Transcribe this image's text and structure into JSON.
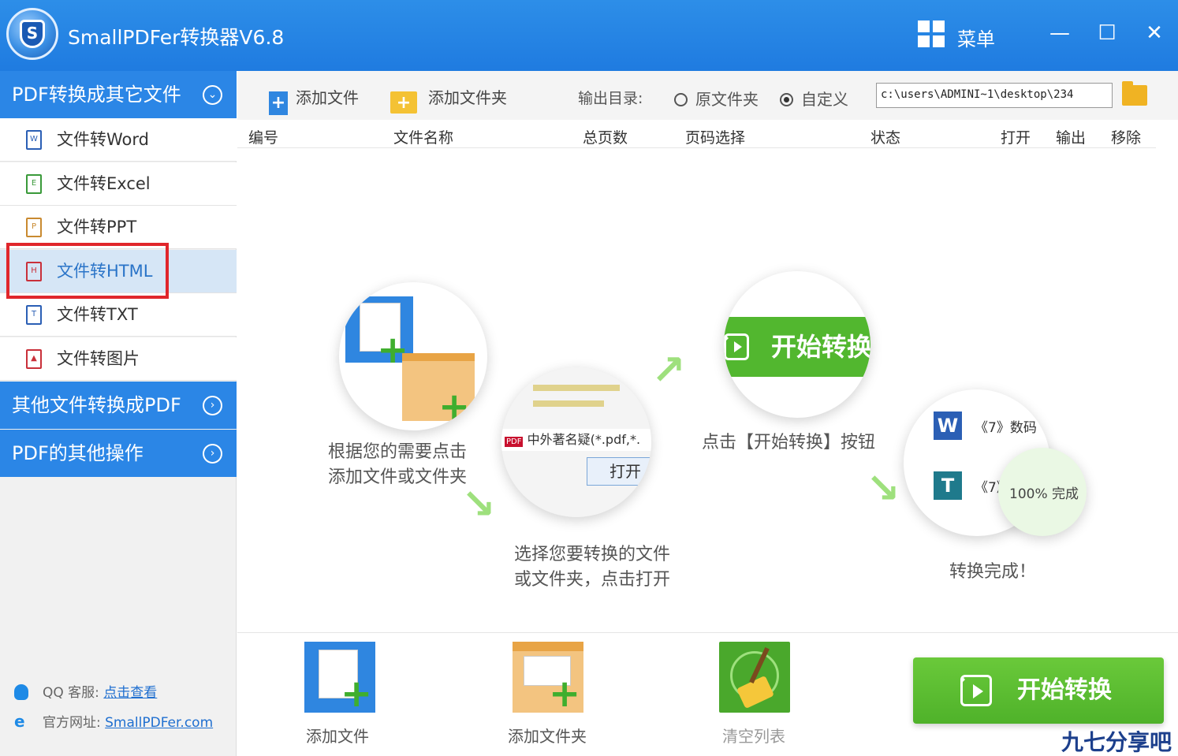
{
  "app": {
    "title": "SmallPDFer转换器V6.8",
    "menu_label": "菜单",
    "minimize": "—",
    "maximize": "☐",
    "close": "✕"
  },
  "sidebar": {
    "section1": "PDF转换成其它文件",
    "items": [
      {
        "label": "文件转Word",
        "icon": "W",
        "color": "#2b5fb5"
      },
      {
        "label": "文件转Excel",
        "icon": "E",
        "color": "#3a9a3a"
      },
      {
        "label": "文件转PPT",
        "icon": "P",
        "color": "#c98a30"
      },
      {
        "label": "文件转HTML",
        "icon": "H",
        "color": "#c9303a"
      },
      {
        "label": "文件转TXT",
        "icon": "T",
        "color": "#2b5fb5"
      },
      {
        "label": "文件转图片",
        "icon": "▲",
        "color": "#c9303a"
      }
    ],
    "section2": "其他文件转换成PDF",
    "section3": "PDF的其他操作",
    "qq_label": "QQ 客服:",
    "qq_link": "点击查看",
    "site_label": "官方网址:",
    "site_link": "SmallPDFer.com"
  },
  "toolbar": {
    "add_file": "添加文件",
    "add_folder": "添加文件夹",
    "output_label": "输出目录:",
    "radio_original": "原文件夹",
    "radio_custom": "自定义",
    "output_path": "c:\\users\\ADMINI~1\\desktop\\234"
  },
  "table_headers": [
    "编号",
    "文件名称",
    "总页数",
    "页码选择",
    "状态",
    "打开",
    "输出",
    "移除"
  ],
  "tutorial": {
    "step1": [
      "根据您的需要点击",
      "添加文件或文件夹"
    ],
    "step2": [
      "选择您要转换的文件",
      "或文件夹，点击打开"
    ],
    "step3": "点击【开始转换】按钮",
    "step4": "转换完成！",
    "mini_start": "开始转换",
    "dialog_file": "中外著名疑",
    "dialog_filter": "(*.pdf,*.",
    "dialog_open": "打开",
    "done_row1": "《7》数码",
    "done_row2": "《7》",
    "done_status": "100%  完成"
  },
  "bottom": {
    "add_file": "添加文件",
    "add_folder": "添加文件夹",
    "clear_list": "清空列表",
    "start": "开始转换"
  },
  "watermark": "九七分享吧"
}
